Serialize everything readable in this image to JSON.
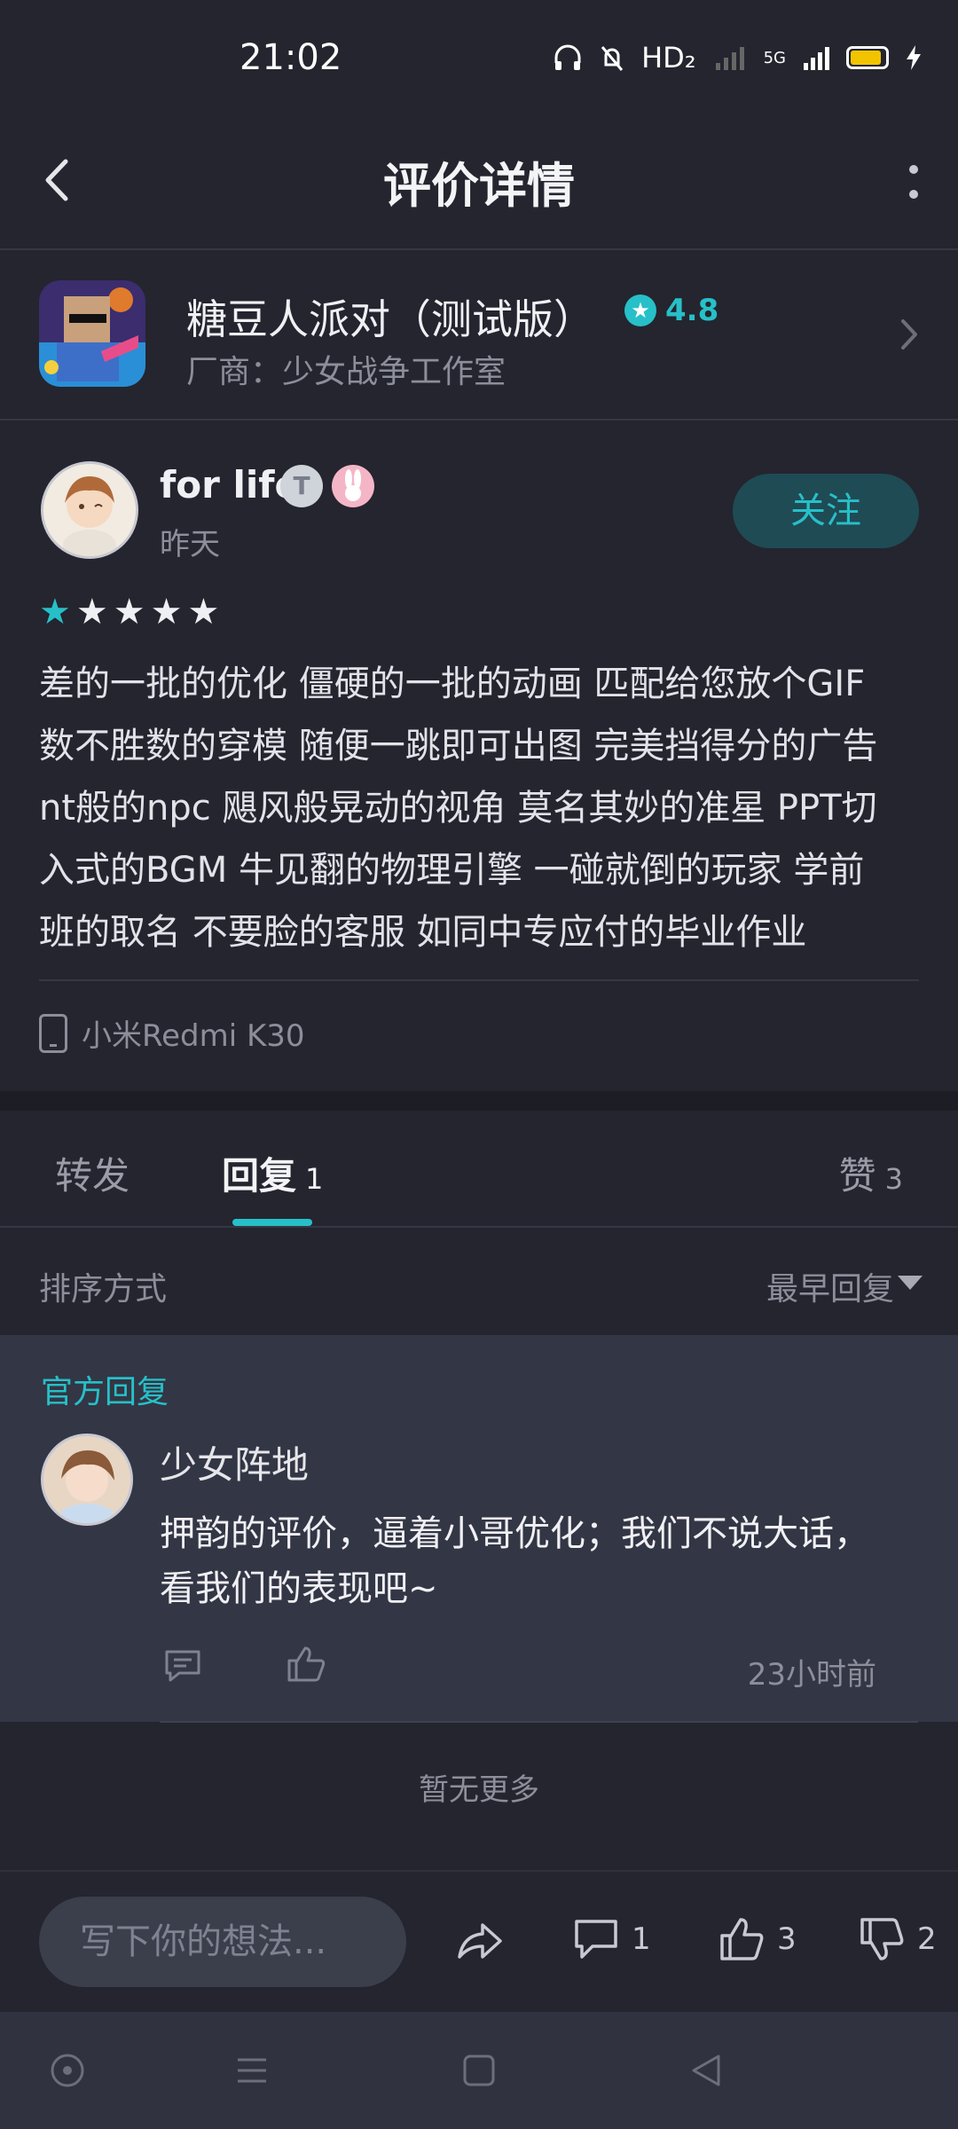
{
  "status_bar": {
    "time": "21:02",
    "network": "HD₂",
    "signal_label": "5G"
  },
  "header": {
    "title": "评价详情"
  },
  "app": {
    "name": "糖豆人派对（测试版）",
    "rating": "4.8",
    "vendor": "厂商：少女战争工作室"
  },
  "review": {
    "username": "for life",
    "badge_t": "T",
    "time": "昨天",
    "follow_label": "关注",
    "stars_filled": 1,
    "stars_total": 5,
    "lines": [
      "差的一批的优化 僵硬的一批的动画 匹配给您放个GIF",
      "数不胜数的穿模 随便一跳即可出图 完美挡得分的广告",
      "nt般的npc 飓风般晃动的视角 莫名其妙的准星 PPT切",
      "入式的BGM 牛见翻的物理引擎 一碰就倒的玩家 学前",
      "班的取名 不要脸的客服 如同中专应付的毕业作业"
    ],
    "device": "小米Redmi K30"
  },
  "tabs": [
    {
      "label": "转发",
      "count": ""
    },
    {
      "label": "回复",
      "count": "1"
    },
    {
      "label": "赞",
      "count": "3"
    }
  ],
  "sort": {
    "label": "排序方式",
    "value": "最早回复"
  },
  "official_reply": {
    "tag": "官方回复",
    "name": "少女阵地",
    "line1": "押韵的评价，逼着小哥优化；我们不说大话，",
    "line2": "看我们的表现吧~",
    "time": "23小时前"
  },
  "no_more": "暂无更多",
  "bottom": {
    "placeholder": "写下你的想法...",
    "comment_count": "1",
    "like_count": "3",
    "dislike_count": "2"
  },
  "colors": {
    "accent": "#27c0c8",
    "background": "#24252f",
    "reply_bg": "#333645"
  }
}
